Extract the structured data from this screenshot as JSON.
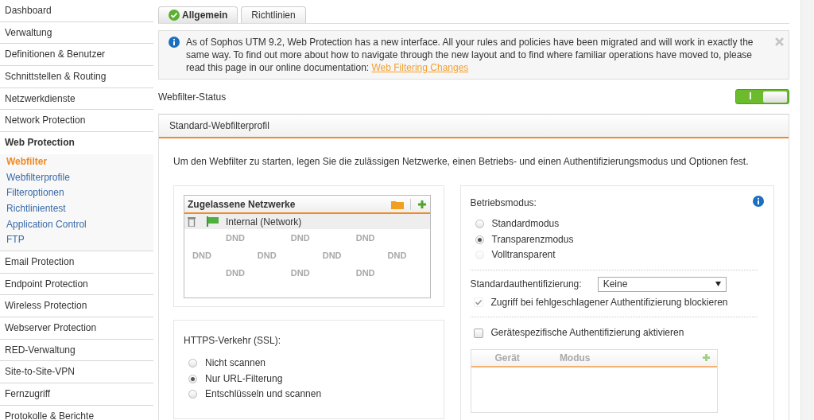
{
  "sidebar": {
    "items": [
      {
        "label": "Dashboard",
        "selected": false
      },
      {
        "label": "Verwaltung",
        "selected": false
      },
      {
        "label": "Definitionen & Benutzer",
        "selected": false
      },
      {
        "label": "Schnittstellen & Routing",
        "selected": false
      },
      {
        "label": "Netzwerkdienste",
        "selected": false
      },
      {
        "label": "Network Protection",
        "selected": false
      },
      {
        "label": "Web Protection",
        "expanded": true,
        "children": [
          {
            "label": "Webfilter",
            "selected": true
          },
          {
            "label": "Webfilterprofile",
            "selected": false
          },
          {
            "label": "Filteroptionen",
            "selected": false
          },
          {
            "label": "Richtlinientest",
            "selected": false
          },
          {
            "label": "Application Control",
            "selected": false
          },
          {
            "label": "FTP",
            "selected": false
          }
        ]
      },
      {
        "label": "Email Protection",
        "selected": false
      },
      {
        "label": "Endpoint Protection",
        "selected": false
      },
      {
        "label": "Wireless Protection",
        "selected": false
      },
      {
        "label": "Webserver Protection",
        "selected": false
      },
      {
        "label": "RED-Verwaltung",
        "selected": false
      },
      {
        "label": "Site-to-Site-VPN",
        "selected": false
      },
      {
        "label": "Fernzugriff",
        "selected": false
      },
      {
        "label": "Protokolle & Berichte",
        "selected": false
      }
    ]
  },
  "tabs": [
    {
      "label": "Allgemein",
      "selected": true
    },
    {
      "label": "Richtlinien",
      "selected": false
    }
  ],
  "notice": {
    "text": "As of Sophos UTM 9.2, Web Protection has a new interface. All your rules and policies have been migrated and will work in exactly the same way. To find out more about how to navigate through the new layout and to find where familiar operations have moved to, please read this page in our online documentation:",
    "link": "Web Filtering Changes"
  },
  "status": {
    "label": "Webfilter-Status",
    "on": true,
    "switch_text": "I"
  },
  "profile": {
    "title": "Standard-Webfilterprofil",
    "intro": "Um den Webfilter zu starten, legen Sie die zulässigen Netzwerke, einen Betriebs- und einen Authentifizierungsmodus und Optionen fest.",
    "networks": {
      "title": "Zugelassene Netzwerke",
      "items": [
        {
          "label": "Internal (Network)"
        }
      ],
      "drop_marks": [
        [
          "DND",
          "DND",
          "DND"
        ],
        [
          "DND",
          "DND",
          "DND",
          "DND"
        ],
        [
          "DND",
          "DND",
          "DND"
        ]
      ]
    },
    "https": {
      "label": "HTTPS-Verkehr (SSL):",
      "options": [
        {
          "label": "Nicht scannen",
          "selected": false,
          "disabled": false
        },
        {
          "label": "Nur URL-Filterung",
          "selected": true,
          "disabled": false
        },
        {
          "label": "Entschlüsseln und scannen",
          "selected": false,
          "disabled": false
        }
      ]
    },
    "mode": {
      "label": "Betriebsmodus:",
      "options": [
        {
          "label": "Standardmodus",
          "selected": false,
          "disabled": false
        },
        {
          "label": "Transparenzmodus",
          "selected": true,
          "disabled": false
        },
        {
          "label": "Volltransparent",
          "selected": false,
          "disabled": true
        }
      ]
    },
    "auth": {
      "label": "Standardauthentifizierung:",
      "value": "Keine",
      "block": {
        "label": "Zugriff bei fehlgeschlagener Authentifizierung blockieren",
        "checked": true,
        "disabled": true
      },
      "device": {
        "label": "Gerätespezifische Authentifizierung aktivieren",
        "checked": false,
        "disabled": false
      },
      "device_table": {
        "columns": [
          "Gerät",
          "Modus"
        ]
      }
    }
  }
}
